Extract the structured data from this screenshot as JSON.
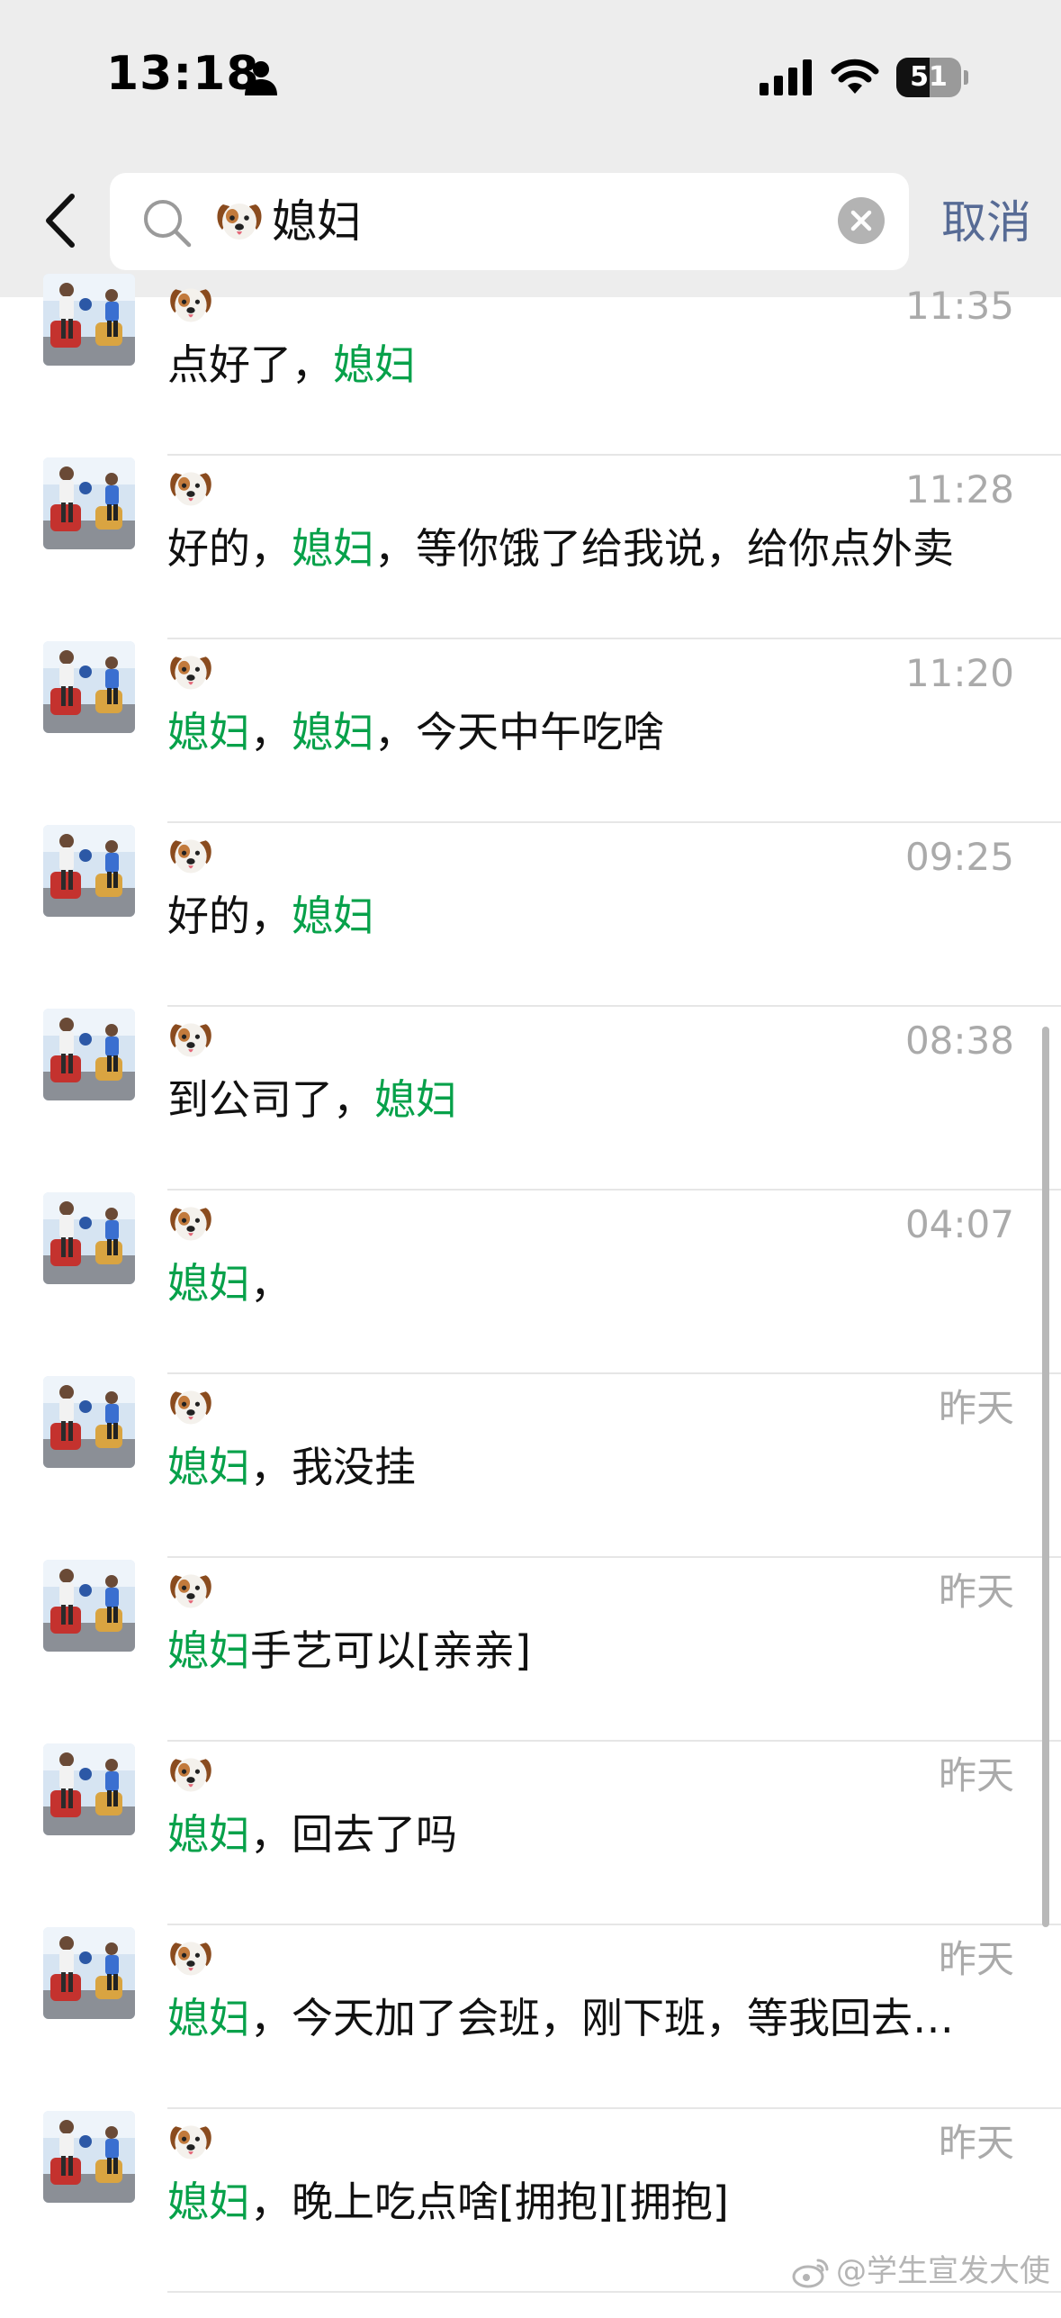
{
  "status_bar": {
    "time": "13:18",
    "battery": "51",
    "battery_level": 0.51
  },
  "search": {
    "query": "媳妇",
    "query_prefix_icon": "dog-face-emoji",
    "cancel_label": "取消"
  },
  "colors": {
    "highlight": "#07a14a",
    "cancel_text": "#576b95",
    "top_background": "#ededed"
  },
  "results": [
    {
      "sender_icon": "dog-face-emoji",
      "time": "11:35",
      "segments": [
        {
          "text": "点好了，",
          "highlight": false
        },
        {
          "text": "媳妇",
          "highlight": true
        }
      ]
    },
    {
      "sender_icon": "dog-face-emoji",
      "time": "11:28",
      "segments": [
        {
          "text": "好的，",
          "highlight": false
        },
        {
          "text": "媳妇",
          "highlight": true
        },
        {
          "text": "，等你饿了给我说，给你点外卖",
          "highlight": false
        }
      ]
    },
    {
      "sender_icon": "dog-face-emoji",
      "time": "11:20",
      "segments": [
        {
          "text": "媳妇",
          "highlight": true
        },
        {
          "text": "，",
          "highlight": false
        },
        {
          "text": "媳妇",
          "highlight": true
        },
        {
          "text": "，今天中午吃啥",
          "highlight": false
        }
      ]
    },
    {
      "sender_icon": "dog-face-emoji",
      "time": "09:25",
      "segments": [
        {
          "text": "好的，",
          "highlight": false
        },
        {
          "text": "媳妇",
          "highlight": true
        }
      ]
    },
    {
      "sender_icon": "dog-face-emoji",
      "time": "08:38",
      "segments": [
        {
          "text": "到公司了，",
          "highlight": false
        },
        {
          "text": "媳妇",
          "highlight": true
        }
      ]
    },
    {
      "sender_icon": "dog-face-emoji",
      "time": "04:07",
      "segments": [
        {
          "text": "媳妇",
          "highlight": true
        },
        {
          "text": "，",
          "highlight": false
        }
      ]
    },
    {
      "sender_icon": "dog-face-emoji",
      "time": "昨天",
      "segments": [
        {
          "text": "媳妇",
          "highlight": true
        },
        {
          "text": "，我没挂",
          "highlight": false
        }
      ]
    },
    {
      "sender_icon": "dog-face-emoji",
      "time": "昨天",
      "segments": [
        {
          "text": "媳妇",
          "highlight": true
        },
        {
          "text": "手艺可以[亲亲]",
          "highlight": false
        }
      ]
    },
    {
      "sender_icon": "dog-face-emoji",
      "time": "昨天",
      "segments": [
        {
          "text": "媳妇",
          "highlight": true
        },
        {
          "text": "，回去了吗",
          "highlight": false
        }
      ]
    },
    {
      "sender_icon": "dog-face-emoji",
      "time": "昨天",
      "segments": [
        {
          "text": "媳妇",
          "highlight": true
        },
        {
          "text": "，今天加了会班，刚下班，等我回去…",
          "highlight": false
        }
      ]
    },
    {
      "sender_icon": "dog-face-emoji",
      "time": "昨天",
      "segments": [
        {
          "text": "媳妇",
          "highlight": true
        },
        {
          "text": "，晚上吃点啥[拥抱][拥抱]",
          "highlight": false
        }
      ]
    }
  ],
  "watermark": "@学生宣发大使"
}
